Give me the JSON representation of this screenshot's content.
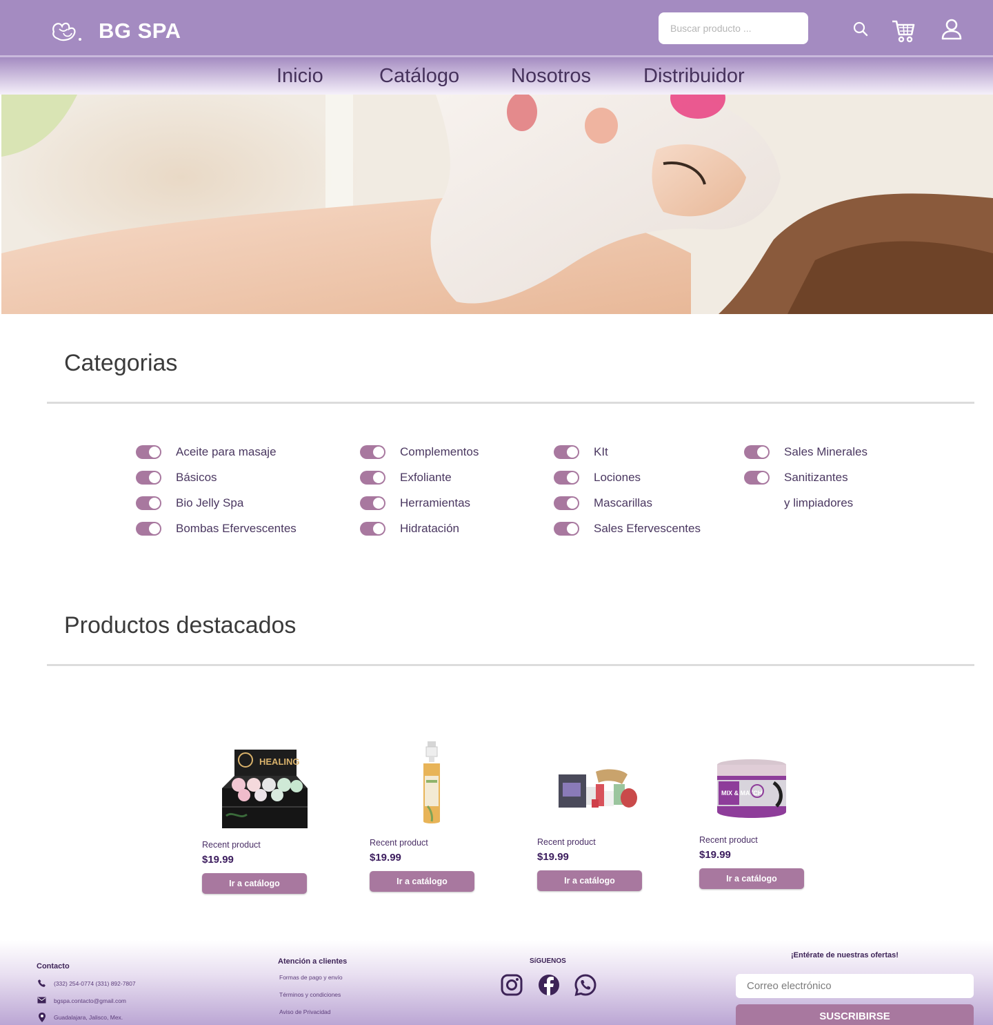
{
  "header": {
    "brand": "BG SPA",
    "search_placeholder": "Buscar producto ...",
    "colors": {
      "header_bg": "#a48bc1",
      "accent": "#a8789f"
    }
  },
  "nav": [
    {
      "label": "Inicio"
    },
    {
      "label": "Catálogo"
    },
    {
      "label": "Nosotros"
    },
    {
      "label": "Distribuidor"
    }
  ],
  "categories": {
    "title": "Categorias",
    "columns": [
      [
        "Aceite para masaje",
        "Básicos",
        "Bio Jelly Spa",
        "Bombas Efervescentes"
      ],
      [
        "Complementos",
        "Exfoliante",
        "Herramientas",
        "Hidratación"
      ],
      [
        "KIt",
        "Lociones",
        "Mascarillas",
        "Sales Efervescentes"
      ],
      [
        "Sales Minerales",
        "Sanitizantes",
        "y limpiadores"
      ]
    ]
  },
  "featured": {
    "title": "Productos destacados",
    "products": [
      {
        "name": "Recent product",
        "price": "$19.99",
        "button": "Ir a catálogo",
        "image_label": "HEALING"
      },
      {
        "name": "Recent product",
        "price": "$19.99",
        "button": "Ir a catálogo"
      },
      {
        "name": "Recent product",
        "price": "$19.99",
        "button": "Ir a catálogo"
      },
      {
        "name": "Recent product",
        "price": "$19.99",
        "button": "Ir a catálogo",
        "image_label": "MIX & MATCH"
      }
    ]
  },
  "footer": {
    "contact": {
      "title": "Contacto",
      "phone": "(332) 254-0774   (331) 892-7807",
      "email": "bgspa.contacto@gmail.com",
      "address": "Guadalajara, Jalisco, Mex."
    },
    "customer_service": {
      "title": "Atención a clientes",
      "links": [
        "Formas de pago y envío",
        "Términos y condiciones",
        "Aviso de Privacidad"
      ]
    },
    "follow": {
      "title": "SíGUENOS",
      "icons": [
        "instagram-icon",
        "facebook-icon",
        "whatsapp-icon"
      ]
    },
    "newsletter": {
      "title": "¡Entérate de nuestras ofertas!",
      "email_placeholder": "Correo electrónico",
      "button": "SUSCRIBIRSE"
    }
  }
}
